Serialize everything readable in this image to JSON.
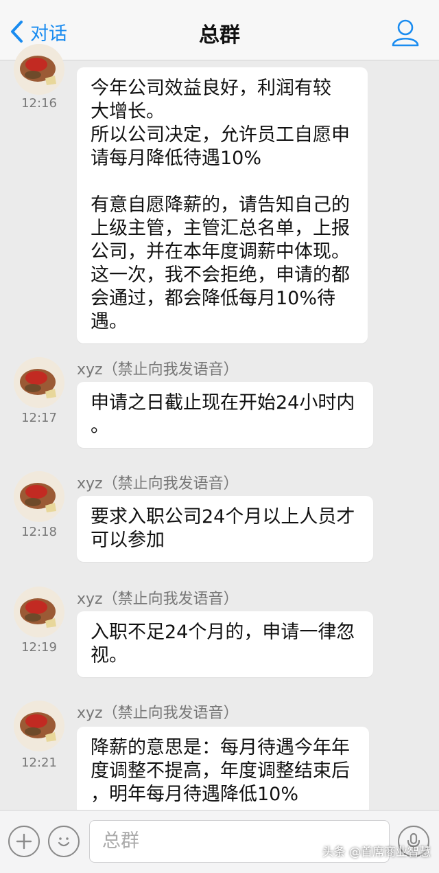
{
  "header": {
    "back_label": "对话",
    "title": "总群",
    "back_icon": "chevron-left-icon",
    "profile_icon": "person-icon",
    "accent_color": "#1a8cf0"
  },
  "messages": [
    {
      "sender": "",
      "time": "12:16",
      "lines": [
        "今年公司效益良好，利润有较",
        "大增长。",
        "所以公司决定，允许员工自愿申",
        "请每月降低待遇10%",
        "",
        "有意自愿降薪的，请告知自己的",
        "上级主管，主管汇总名单，上报",
        "公司，并在本年度调薪中体现。",
        "这一次，我不会拒绝，申请的都",
        "会通过，都会降低每月10%待",
        "遇。"
      ]
    },
    {
      "sender": "xyz（禁止向我发语音）",
      "time": "12:17",
      "lines": [
        "申请之日截止现在开始24小时内",
        "。"
      ]
    },
    {
      "sender": "xyz（禁止向我发语音）",
      "time": "12:18",
      "lines": [
        "要求入职公司24个月以上人员才",
        "可以参加"
      ]
    },
    {
      "sender": "xyz（禁止向我发语音）",
      "time": "12:19",
      "lines": [
        "入职不足24个月的，申请一律忽",
        "视。"
      ]
    },
    {
      "sender": "xyz（禁止向我发语音）",
      "time": "12:21",
      "lines": [
        "降薪的意思是：每月待遇今年年",
        "度调整不提高，年度调整结束后",
        "，明年每月待遇降低10%"
      ]
    }
  ],
  "input_bar": {
    "placeholder": "总群",
    "add_icon": "plus-icon",
    "emoji_icon": "smiley-icon",
    "voice_icon": "microphone-icon"
  },
  "watermark": "头条 @首席商业智慧"
}
